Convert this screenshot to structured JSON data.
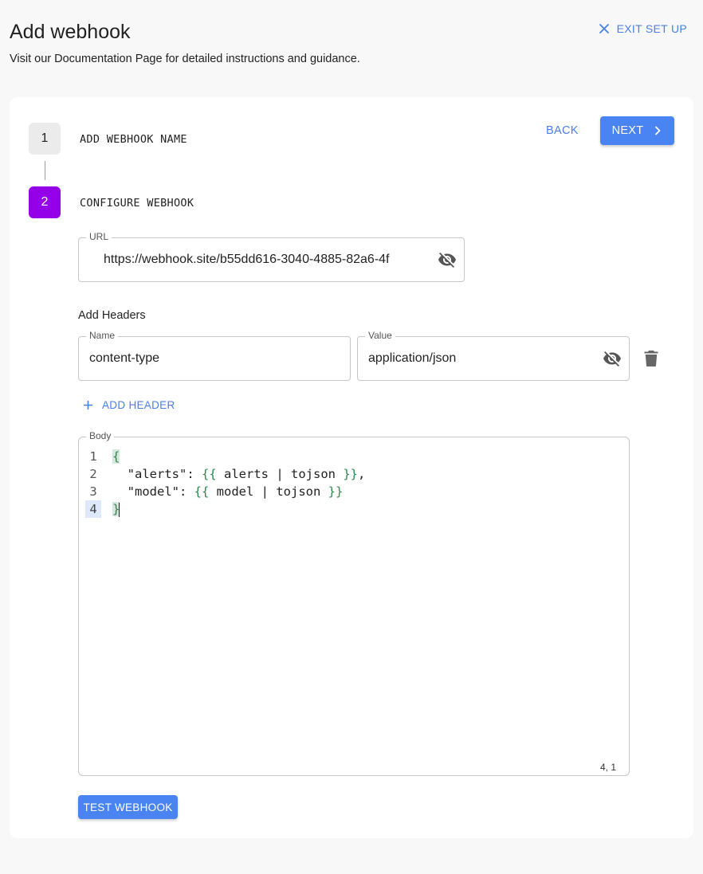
{
  "header": {
    "title": "Add webhook",
    "subtitle": "Visit our Documentation Page for detailed instructions and guidance.",
    "exit_label": "EXIT SET UP"
  },
  "steps": [
    {
      "number": "1",
      "label": "ADD WEBHOOK NAME"
    },
    {
      "number": "2",
      "label": "CONFIGURE WEBHOOK"
    }
  ],
  "nav": {
    "back_label": "BACK",
    "next_label": "NEXT"
  },
  "url_field": {
    "label": "URL",
    "value": "https://webhook.site/b55dd616-3040-4885-82a6-4f"
  },
  "headers": {
    "section_label": "Add Headers",
    "name_label": "Name",
    "name_value": "content-type",
    "value_label": "Value",
    "value_value": "application/json",
    "add_label": "ADD HEADER"
  },
  "body": {
    "label": "Body",
    "lines": [
      {
        "num": "1",
        "indent": "",
        "pre": "",
        "open": "{",
        "mid": "",
        "close": "",
        "post": ""
      },
      {
        "num": "2",
        "indent": "  ",
        "pre": "\"alerts\": ",
        "open": "{{",
        "mid": " alerts | tojson ",
        "close": "}}",
        "post": ","
      },
      {
        "num": "3",
        "indent": "  ",
        "pre": "\"model\": ",
        "open": "{{",
        "mid": " model | tojson ",
        "close": "}}",
        "post": ""
      },
      {
        "num": "4",
        "indent": "",
        "pre": "",
        "open": "}",
        "mid": "",
        "close": "",
        "post": ""
      }
    ],
    "cursor_position": "4, 1"
  },
  "test_label": "TEST WEBHOOK",
  "colors": {
    "accent": "#4a83f2",
    "active_step": "#9400e8",
    "link": "#4a7fe8",
    "template_brace": "#2a8a4a"
  }
}
